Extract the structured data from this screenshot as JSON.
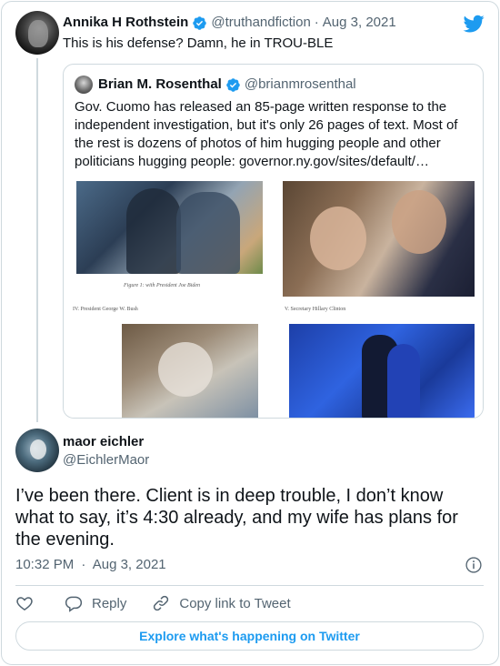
{
  "parent_tweet": {
    "name": "Annika H Rothstein",
    "handle": "@truthandfiction",
    "separator": "·",
    "date": "Aug 3, 2021",
    "text": "This is his defense? Damn, he in TROU-BLE"
  },
  "quoted_tweet": {
    "name": "Brian M. Rosenthal",
    "handle": "@brianmrosenthal",
    "text": "Gov. Cuomo has released an 85-page written response to the independent investigation, but it's only 26 pages of text. Most of the rest is dozens of photos of him hugging people and other politicians hugging people: governor.ny.gov/sites/default/…",
    "media": {
      "caption_1": "Figure 1: with President Joe Biden",
      "caption_2": "IV.     President George W. Bush",
      "caption_3": "V.      Secretary Hillary Clinton"
    }
  },
  "reply": {
    "name": "maor eichler",
    "handle": "@EichlerMaor",
    "text": "I’ve been there. Client is in deep trouble, I don’t know what to say, it’s 4:30 already, and my wife has plans for the evening.",
    "time": "10:32 PM",
    "separator": "·",
    "date": "Aug 3, 2021"
  },
  "actions": {
    "reply_label": "Reply",
    "copy_link_label": "Copy link to Tweet"
  },
  "footer": {
    "explore_label": "Explore what's happening on Twitter"
  },
  "colors": {
    "accent": "#1d9bf0",
    "text": "#0f1419",
    "secondary": "#536471",
    "border": "#cfd9de"
  },
  "icons": [
    "twitter-bird-icon",
    "verified-badge-icon",
    "info-icon",
    "heart-icon",
    "reply-icon",
    "link-icon"
  ]
}
